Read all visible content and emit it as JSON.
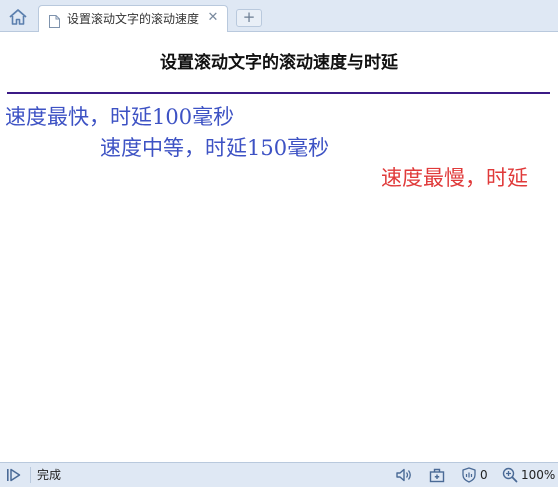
{
  "browser": {
    "tab": {
      "title": "设置滚动文字的滚动速度",
      "close_glyph": "✕",
      "icon": "page-icon"
    },
    "new_tab_glyph": "+",
    "home_icon": "home-icon"
  },
  "page": {
    "heading": "设置滚动文字的滚动速度与时延",
    "rule_color": "#3b1a86",
    "marquees": [
      {
        "text": "速度最快，时延100毫秒",
        "color": "#3d52c4"
      },
      {
        "text": "速度中等，时延150毫秒",
        "color": "#3d52c4"
      },
      {
        "text": "速度最慢，时延",
        "color": "#e03a3a"
      }
    ]
  },
  "statusbar": {
    "status_text": "完成",
    "blocked_count": "0",
    "zoom": "100%",
    "icons": [
      "play-icon",
      "sound-icon",
      "toolbox-icon",
      "shield-icon",
      "zoom-icon"
    ]
  },
  "colors": {
    "chrome_bg": "#dfe8f4",
    "chrome_border": "#b9c9dd",
    "marquee_blue": "#3d52c4",
    "marquee_red": "#e03a3a"
  }
}
